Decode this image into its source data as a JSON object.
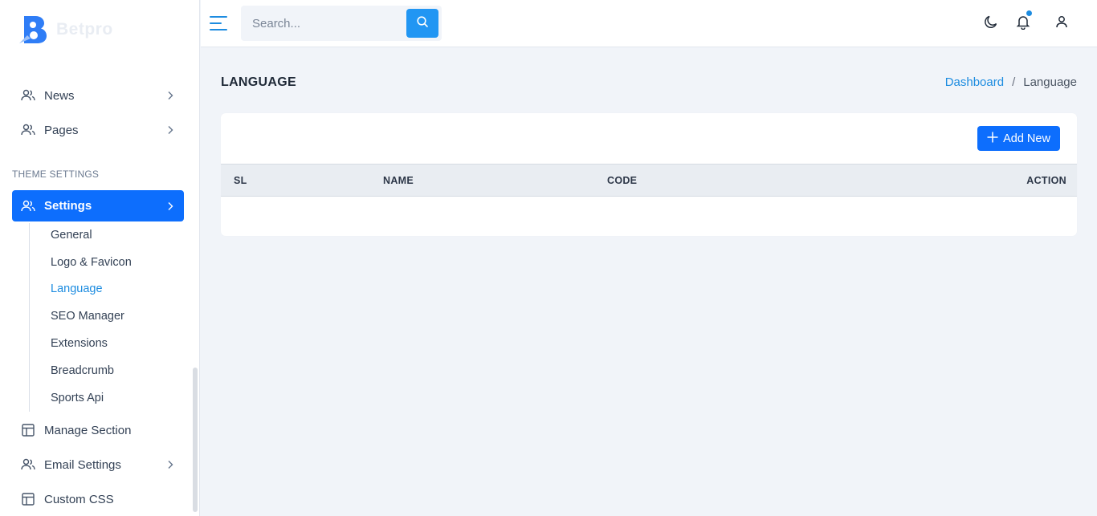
{
  "brand": {
    "name": "Betpro",
    "accent": "#0d6efd",
    "link_color": "#1d8ce0"
  },
  "sidebar": {
    "items_top": [
      {
        "label": "News",
        "icon": "users-icon",
        "has_chevron": true
      },
      {
        "label": "Pages",
        "icon": "users-icon",
        "has_chevron": true
      }
    ],
    "section_title": "THEME SETTINGS",
    "settings": {
      "label": "Settings",
      "icon": "users-icon",
      "active": true
    },
    "submenu": [
      {
        "label": "General"
      },
      {
        "label": "Logo & Favicon"
      },
      {
        "label": "Language",
        "active": true
      },
      {
        "label": "SEO Manager"
      },
      {
        "label": "Extensions"
      },
      {
        "label": "Breadcrumb"
      },
      {
        "label": "Sports Api"
      }
    ],
    "items_bottom": [
      {
        "label": "Manage Section",
        "icon": "layout-icon",
        "has_chevron": false
      },
      {
        "label": "Email Settings",
        "icon": "users-icon",
        "has_chevron": true
      },
      {
        "label": "Custom CSS",
        "icon": "layout-icon",
        "has_chevron": false
      }
    ]
  },
  "topbar": {
    "search_placeholder": "Search...",
    "icons": [
      "moon-icon",
      "bell-icon",
      "user-icon"
    ]
  },
  "page": {
    "title": "LANGUAGE",
    "breadcrumb": {
      "link": "Dashboard",
      "separator": "/",
      "current": "Language"
    }
  },
  "table": {
    "add_button_label": "Add New",
    "columns": [
      "SL",
      "NAME",
      "CODE",
      "ACTION"
    ],
    "rows": []
  }
}
